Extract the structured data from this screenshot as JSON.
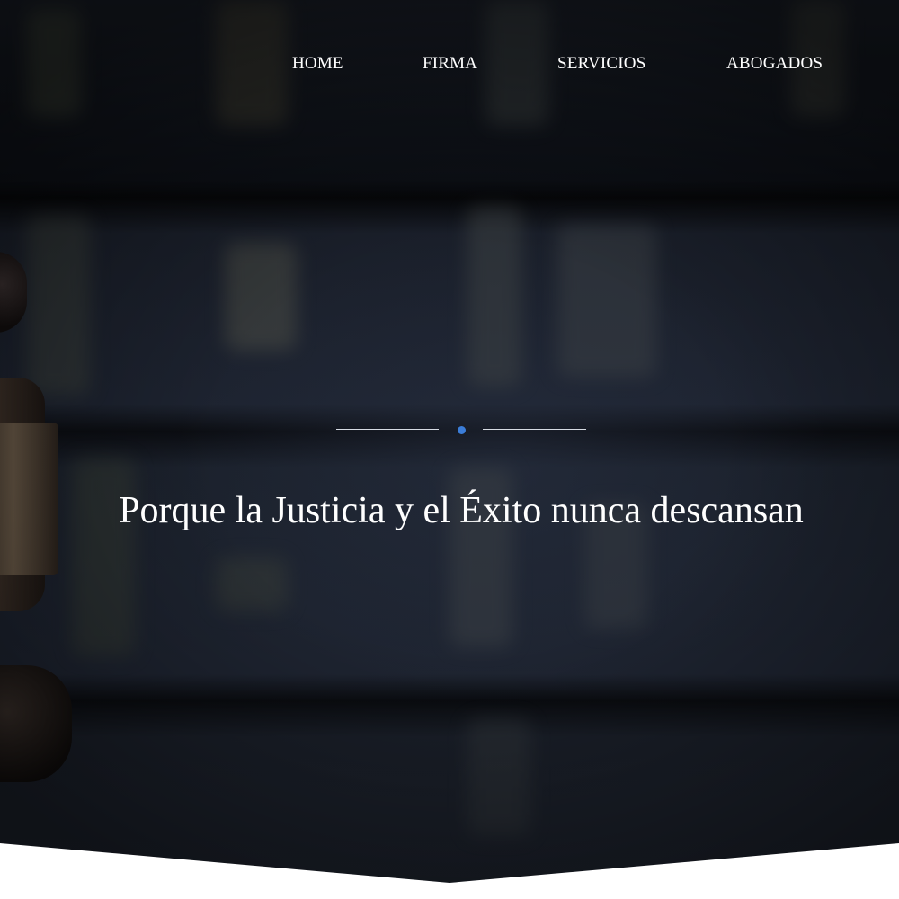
{
  "nav": {
    "items": [
      {
        "label": "HOME"
      },
      {
        "label": "FIRMA"
      },
      {
        "label": "SERVICIOS"
      },
      {
        "label": "ABOGADOS"
      }
    ]
  },
  "hero": {
    "tagline": "Porque la Justicia y el Éxito nunca descansan"
  },
  "colors": {
    "accent": "#3b7dd8",
    "text": "#ffffff",
    "background_dark": "#0f1219",
    "section_bottom": "#ffffff"
  },
  "icons": [
    "divider-dot-icon"
  ]
}
